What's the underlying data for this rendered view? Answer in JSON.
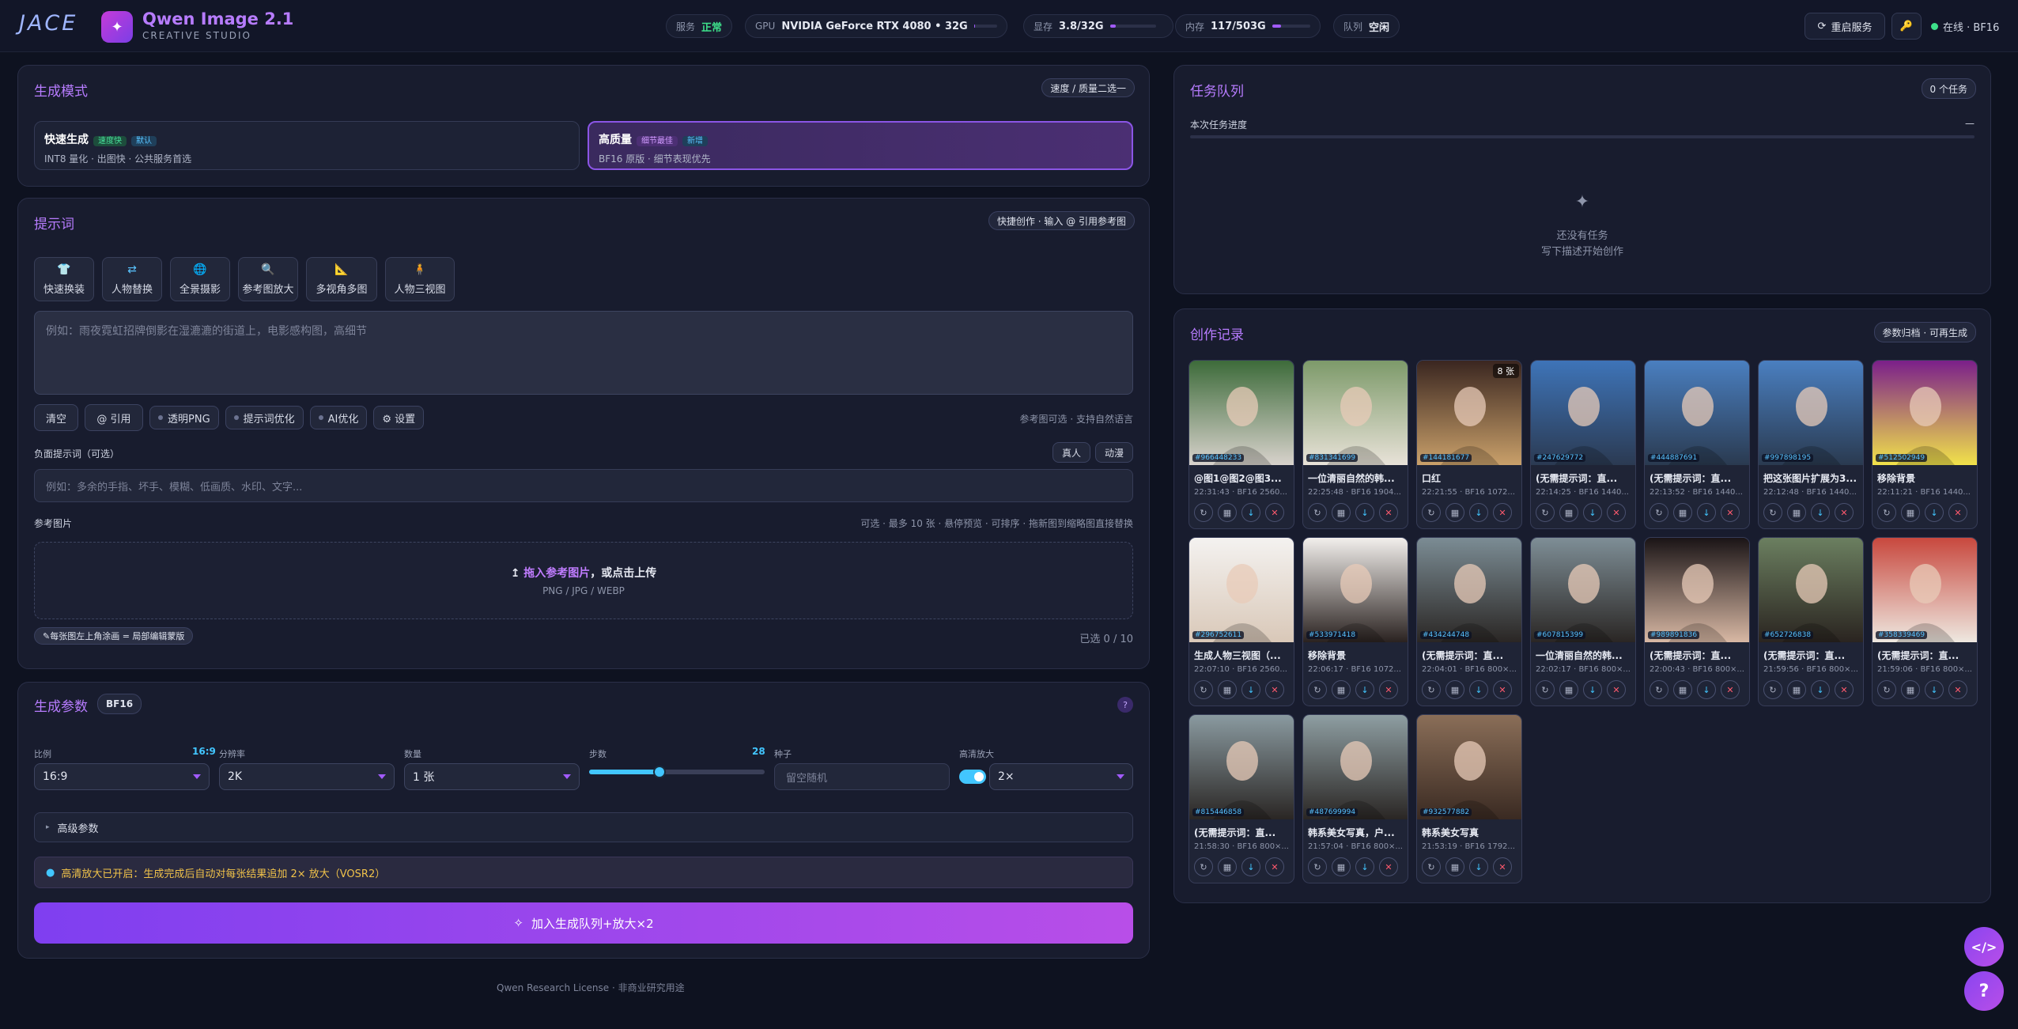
{
  "header": {
    "logo": "JACE",
    "app_title": "Qwen Image 2.1",
    "app_subtitle": "CREATIVE STUDIO",
    "service_label": "服务",
    "service_value": "正常",
    "gpu_label": "GPU",
    "gpu_value": "NVIDIA GeForce RTX 4080 • 32G",
    "gpu_usage": 0.05,
    "vram_label": "显存",
    "vram_value": "3.8/32G",
    "vram_usage": 0.12,
    "mem_label": "内存",
    "mem_value": "117/503G",
    "mem_usage": 0.23,
    "queue_label": "队列",
    "queue_value": "空闲",
    "restart_label": "重启服务",
    "key_icon": "key-icon",
    "online_label": "在线 · BF16"
  },
  "mode": {
    "title": "生成模式",
    "tag": "速度 / 质量二选一",
    "fast": {
      "title": "快速生成",
      "badge1": "速度快",
      "badge2": "默认",
      "desc": "INT8 量化 · 出图快 · 公共服务首选"
    },
    "hq": {
      "title": "高质量",
      "badge1": "细节最佳",
      "badge2": "新增",
      "desc": "BF16 原版 · 细节表现优先"
    }
  },
  "prompt": {
    "title": "提示词",
    "tag": "快捷创作 · 输入 @ 引用参考图",
    "tools": [
      {
        "label": "快速换装",
        "icon": "shirt-icon",
        "glyph": "👕"
      },
      {
        "label": "人物替换",
        "icon": "swap-icon",
        "glyph": "⇄"
      },
      {
        "label": "全景摄影",
        "icon": "globe-icon",
        "glyph": "🌐"
      },
      {
        "label": "参考图放大",
        "icon": "zoom-icon",
        "glyph": "🔍"
      },
      {
        "label": "多视角多图",
        "icon": "angle-icon",
        "glyph": "📐"
      },
      {
        "label": "人物三视图",
        "icon": "figure-icon",
        "glyph": "🧍"
      }
    ],
    "placeholder": "例如：雨夜霓虹招牌倒影在湿漉漉的街道上，电影感构图，高细节",
    "clear": "清空",
    "cite": "@ 引用",
    "png": "透明PNG",
    "optimize": "提示词优化",
    "ai": "AI优化",
    "settings": "⚙ 设置",
    "right_hint": "参考图可选 · 支持自然语言",
    "neg_label": "负面提示词（可选）",
    "neg_btn1": "真人",
    "neg_btn2": "动漫",
    "neg_placeholder": "例如：多余的手指、坏手、模糊、低画质、水印、文字...",
    "ref_label": "参考图片",
    "ref_hint": "可选 · 最多 10 张 · 悬停预览 · 可排序 · 拖新图到缩略图直接替换",
    "upload_main": "拖入参考图片",
    "upload_tail": "，或点击上传",
    "upload_types": "PNG / JPG / WEBP",
    "edit_tag": "每张图左上角涂画 = 局部编辑蒙版",
    "count": "已选 0 / 10"
  },
  "params": {
    "title": "生成参数",
    "precision": "BF16",
    "help": "?",
    "ratio_label": "比例",
    "ratio_hint": "16:9",
    "ratio": "16:9",
    "res_label": "分辨率",
    "res": "2K",
    "count_label": "数量",
    "count": "1 张",
    "steps_label": "步数",
    "steps": "28",
    "steps_fraction": 0.4,
    "seed_label": "种子",
    "seed_placeholder": "留空随机",
    "upscale_label": "高清放大",
    "upscale": "2×",
    "advanced": "高级参数",
    "notice": "高清放大已开启：生成完成后自动对每张结果追加 2× 放大（VOSR2）",
    "generate": "加入生成队列+放大×2"
  },
  "footer": "Qwen Research License · 非商业研究用途",
  "queue": {
    "title": "任务队列",
    "tag": "0 个任务",
    "progress_label": "本次任务进度",
    "progress_value": "—",
    "empty1": "还没有任务",
    "empty2": "写下描述开始创作"
  },
  "gallery": {
    "title": "创作记录",
    "tag": "参数归档 · 可再生成",
    "items": [
      {
        "id": "#966448233",
        "title": "@图1@图2@图3...",
        "meta": "22:31:43 · BF16 2560...",
        "c1": "#3d6b3a",
        "c2": "#d8d2cc",
        "count": ""
      },
      {
        "id": "#831341699",
        "title": "一位清丽自然的韩...",
        "meta": "22:25:48 · BF16 1904...",
        "c1": "#7d9a6a",
        "c2": "#e8e2d8",
        "count": ""
      },
      {
        "id": "#144181677",
        "title": "口红",
        "meta": "22:21:55 · BF16 1072...",
        "c1": "#3a2620",
        "c2": "#c9a06a",
        "count": "8 张"
      },
      {
        "id": "#247629772",
        "title": "(无需提示词：直...",
        "meta": "22:14:25 · BF16 1440...",
        "c1": "#3e74b8",
        "c2": "#2b3a52",
        "count": ""
      },
      {
        "id": "#444887691",
        "title": "(无需提示词：直...",
        "meta": "22:13:52 · BF16 1440...",
        "c1": "#4a7fc0",
        "c2": "#2a3a50",
        "count": ""
      },
      {
        "id": "#997898195",
        "title": "把这张图片扩展为3...",
        "meta": "22:12:48 · BF16 1440...",
        "c1": "#4a7fc0",
        "c2": "#2a3a50",
        "count": ""
      },
      {
        "id": "#512502949",
        "title": "移除背景",
        "meta": "22:11:21 · BF16 1440...",
        "c1": "#7b1f8a",
        "c2": "#f1e24a",
        "count": ""
      },
      {
        "id": "#296752611",
        "title": "生成人物三视图（...",
        "meta": "22:07:10 · BF16 2560...",
        "c1": "#f4f2f0",
        "c2": "#d9c8b8",
        "count": ""
      },
      {
        "id": "#533971418",
        "title": "移除背景",
        "meta": "22:06:17 · BF16 1072...",
        "c1": "#f2efec",
        "c2": "#2a2220",
        "count": ""
      },
      {
        "id": "#434244748",
        "title": "(无需提示词：直...",
        "meta": "22:04:01 · BF16 800×...",
        "c1": "#7b8c94",
        "c2": "#2a2624",
        "count": ""
      },
      {
        "id": "#607815399",
        "title": "一位清丽自然的韩...",
        "meta": "22:02:17 · BF16 800×...",
        "c1": "#7e8e96",
        "c2": "#2a2624",
        "count": ""
      },
      {
        "id": "#989891836",
        "title": "(无需提示词：直...",
        "meta": "22:00:43 · BF16 800×...",
        "c1": "#1a1416",
        "c2": "#d8b8a4",
        "count": ""
      },
      {
        "id": "#652726838",
        "title": "(无需提示词：直...",
        "meta": "21:59:56 · BF16 800×...",
        "c1": "#6b7f60",
        "c2": "#2a2420",
        "count": ""
      },
      {
        "id": "#358339469",
        "title": "(无需提示词：直...",
        "meta": "21:59:06 · BF16 800×...",
        "c1": "#c8483e",
        "c2": "#eee8e0",
        "count": ""
      },
      {
        "id": "#815446858",
        "title": "(无需提示词：直...",
        "meta": "21:58:30 · BF16 800×...",
        "c1": "#8a9aa0",
        "c2": "#2a2624",
        "count": ""
      },
      {
        "id": "#487699994",
        "title": "韩系美女写真，户...",
        "meta": "21:57:04 · BF16 800×...",
        "c1": "#8e9ea2",
        "c2": "#2a2624",
        "count": ""
      },
      {
        "id": "#932577882",
        "title": "韩系美女写真",
        "meta": "21:53:19 · BF16 1792...",
        "c1": "#8a6e58",
        "c2": "#3a2a22",
        "count": ""
      }
    ]
  },
  "fab": {
    "code": "</>",
    "help": "?"
  }
}
